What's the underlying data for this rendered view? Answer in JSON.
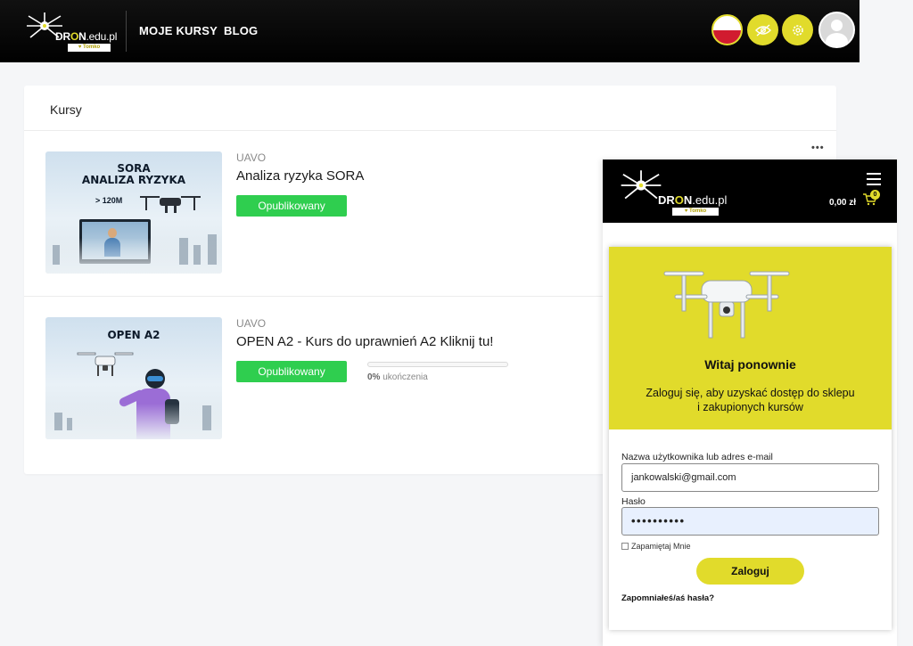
{
  "header": {
    "logo": {
      "brand_prefix": "DR",
      "brand_o": "O",
      "brand_suffix": "N",
      "brand_domain": ".edu.pl",
      "tag": "♥ Tomko"
    },
    "nav": [
      {
        "label": "MOJE KURSY"
      },
      {
        "label": "BLOG"
      }
    ],
    "icons": {
      "language": "poland-flag-icon",
      "eye": "eye-slash-icon",
      "settings": "gear-icon",
      "avatar": "user-avatar-icon"
    },
    "accent_color": "#e1db2b"
  },
  "courses": {
    "title": "Kursy",
    "more_icon": "•••",
    "items": [
      {
        "category": "UAVO",
        "title": "Analiza ryzyka SORA",
        "status_label": "Opublikowany",
        "thumb": {
          "line1": "SORA",
          "line2": "ANALIZA RYZYKA",
          "height_label": "120M"
        }
      },
      {
        "category": "UAVO",
        "title": "OPEN A2 - Kurs do uprawnień A2 Kliknij tu!",
        "status_label": "Opublikowany",
        "thumb": {
          "line1": "OPEN A2"
        },
        "progress": {
          "value_percent": 0,
          "value_label": "0%",
          "suffix": " ukończenia"
        }
      }
    ],
    "status_color": "#2fce4f"
  },
  "mobile": {
    "logo": {
      "brand_prefix": "DR",
      "brand_o": "O",
      "brand_suffix": "N",
      "brand_domain": ".edu.pl",
      "tag": "♥ Tomko"
    },
    "cart": {
      "price": "0,00 zł",
      "count": "0"
    },
    "login": {
      "welcome": "Witaj ponownie",
      "subtitle": "Zaloguj się, aby uzyskać dostęp do sklepu i zakupionych kursów",
      "username_label": "Nazwa użytkownika lub adres e-mail",
      "username_value": "jankowalski@gmail.com",
      "password_label": "Hasło",
      "password_value": "••••••••••",
      "remember_label": "Zapamiętaj Mnie",
      "submit_label": "Zaloguj",
      "forgot_label": "Zapomniałeś/aś hasła?"
    }
  }
}
